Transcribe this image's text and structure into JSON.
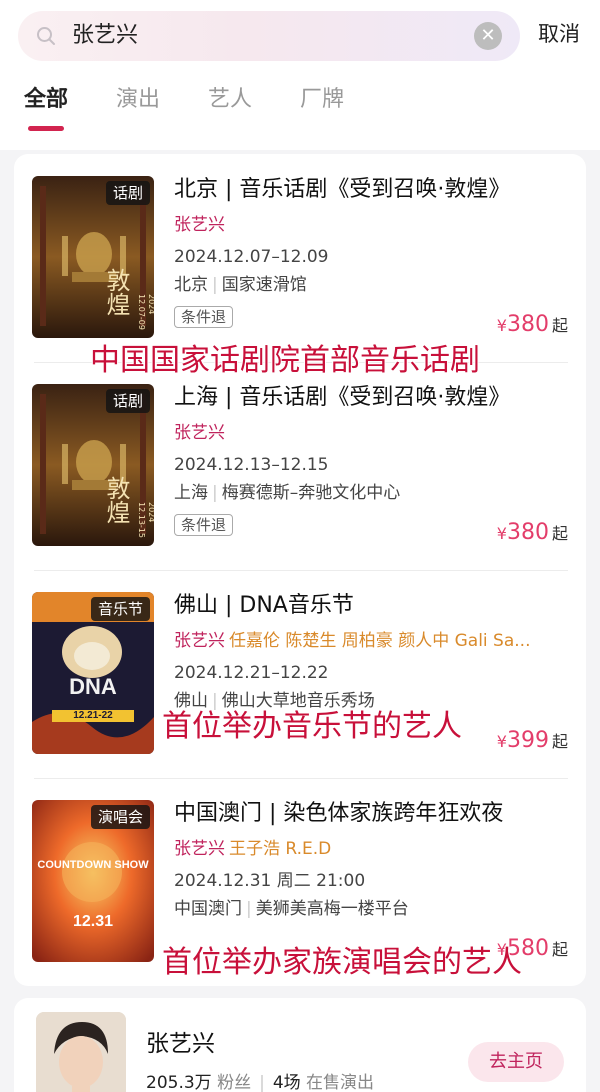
{
  "search": {
    "query": "张艺兴",
    "cancel_label": "取消"
  },
  "tabs": [
    "全部",
    "演出",
    "艺人",
    "厂牌"
  ],
  "shows": [
    {
      "tag": "话剧",
      "title": "北京 | 音乐话剧《受到召唤·敦煌》",
      "artist_main": "张艺兴",
      "artists_other": "",
      "date": "2024.12.07–12.09",
      "city": "北京",
      "venue": "国家速滑馆",
      "refund_label": "条件退",
      "price_symbol": "¥",
      "price": "380",
      "price_suffix": "起",
      "poster_text": "敦煌",
      "poster_date": "2024 12.07-09"
    },
    {
      "tag": "话剧",
      "title": "上海 | 音乐话剧《受到召唤·敦煌》",
      "artist_main": "张艺兴",
      "artists_other": "",
      "date": "2024.12.13–12.15",
      "city": "上海",
      "venue": "梅赛德斯–奔驰文化中心",
      "refund_label": "条件退",
      "price_symbol": "¥",
      "price": "380",
      "price_suffix": "起",
      "poster_text": "敦煌",
      "poster_date": "2024 12.13-15"
    },
    {
      "tag": "音乐节",
      "title": "佛山 | DNA音乐节",
      "artist_main": "张艺兴",
      "artists_other": "任嘉伦 陈楚生 周柏豪 颜人中 Gali Sa...",
      "date": "2024.12.21–12.22",
      "city": "佛山",
      "venue": "佛山大草地音乐秀场",
      "refund_label": "",
      "price_symbol": "¥",
      "price": "399",
      "price_suffix": "起",
      "poster_text": "DNA",
      "poster_date": "12.21-22"
    },
    {
      "tag": "演唱会",
      "title": "中国澳门 | 染色体家族跨年狂欢夜",
      "artist_main": "张艺兴",
      "artists_other": "王子浩 R.E.D",
      "date": "2024.12.31 周二 21:00",
      "city": "中国澳门",
      "venue": "美狮美高梅一楼平台",
      "refund_label": "",
      "price_symbol": "¥",
      "price": "580",
      "price_suffix": "起",
      "poster_text": "COUNTDOWN SHOW",
      "poster_date": "12.31"
    }
  ],
  "annotations": [
    "中国国家话剧院首部音乐话剧",
    "首位举办音乐节的艺人",
    "首位举办家族演唱会的艺人"
  ],
  "artist": {
    "name": "张艺兴",
    "followers_value": "205.3万",
    "followers_label": "粉丝",
    "shows_value": "4场",
    "shows_label": "在售演出",
    "home_button": "去主页"
  },
  "colors": {
    "accent": "#d2244f",
    "artist_main": "#c0245d",
    "artist_other": "#d98a2b",
    "price": "#e33d6a",
    "annotation": "#c8103a"
  }
}
